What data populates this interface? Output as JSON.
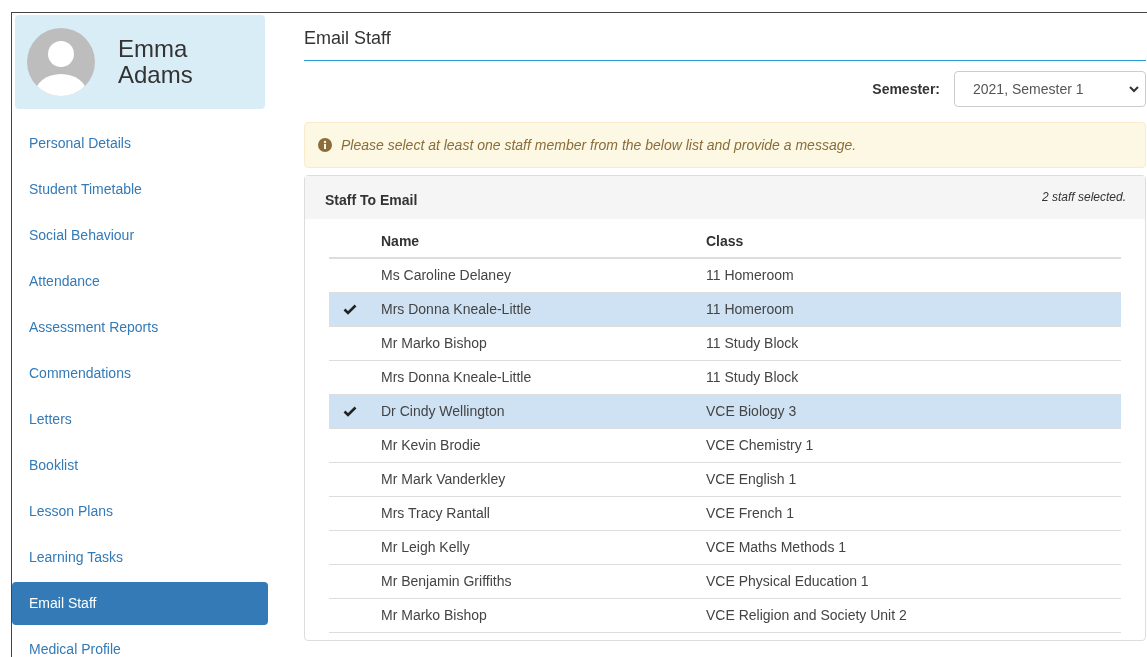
{
  "profile": {
    "name": "Emma Adams"
  },
  "sidebar": {
    "items": [
      {
        "label": "Personal Details",
        "selected": false
      },
      {
        "label": "Student Timetable",
        "selected": false
      },
      {
        "label": "Social Behaviour",
        "selected": false
      },
      {
        "label": "Attendance",
        "selected": false
      },
      {
        "label": "Assessment Reports",
        "selected": false
      },
      {
        "label": "Commendations",
        "selected": false
      },
      {
        "label": "Letters",
        "selected": false
      },
      {
        "label": "Booklist",
        "selected": false
      },
      {
        "label": "Lesson Plans",
        "selected": false
      },
      {
        "label": "Learning Tasks",
        "selected": false
      },
      {
        "label": "Email Staff",
        "selected": true
      },
      {
        "label": "Medical Profile",
        "selected": false
      }
    ]
  },
  "page_title": "Email Staff",
  "semester": {
    "label": "Semester:",
    "value": "2021, Semester 1"
  },
  "alert": "Please select at least one staff member from the below list and provide a message.",
  "panel": {
    "title": "Staff To Email",
    "count": "2 staff selected.",
    "columns": [
      "Name",
      "Class"
    ],
    "rows": [
      {
        "name": "Ms Caroline Delaney",
        "class": "11 Homeroom",
        "selected": false
      },
      {
        "name": "Mrs Donna Kneale-Little",
        "class": "11 Homeroom",
        "selected": true
      },
      {
        "name": "Mr Marko Bishop",
        "class": "11 Study Block",
        "selected": false
      },
      {
        "name": "Mrs Donna Kneale-Little",
        "class": "11 Study Block",
        "selected": false
      },
      {
        "name": "Dr Cindy Wellington",
        "class": "VCE Biology 3",
        "selected": true
      },
      {
        "name": "Mr Kevin Brodie",
        "class": "VCE Chemistry 1",
        "selected": false
      },
      {
        "name": "Mr Mark Vanderkley",
        "class": "VCE English 1",
        "selected": false
      },
      {
        "name": "Mrs Tracy Rantall",
        "class": "VCE French 1",
        "selected": false
      },
      {
        "name": "Mr Leigh Kelly",
        "class": "VCE Maths Methods 1",
        "selected": false
      },
      {
        "name": "Mr Benjamin Griffiths",
        "class": "VCE Physical Education 1",
        "selected": false
      },
      {
        "name": "Mr Marko Bishop",
        "class": "VCE Religion and Society Unit 2",
        "selected": false
      }
    ]
  }
}
